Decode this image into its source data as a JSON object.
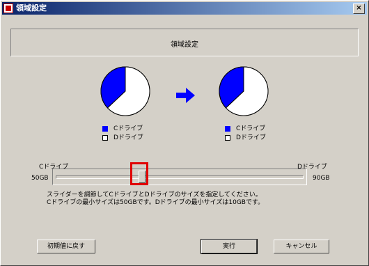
{
  "window": {
    "title": "領域設定",
    "close_glyph": "×"
  },
  "header": {
    "label": "領域設定"
  },
  "charts": {
    "type": "pie",
    "before": {
      "slices": [
        {
          "name": "Cドライブ",
          "fraction": 0.37,
          "color": "#0000ff"
        },
        {
          "name": "Dドライブ",
          "fraction": 0.63,
          "color": "#ffffff"
        }
      ]
    },
    "after": {
      "slices": [
        {
          "name": "Cドライブ",
          "fraction": 0.37,
          "color": "#0000ff"
        },
        {
          "name": "Dドライブ",
          "fraction": 0.63,
          "color": "#ffffff"
        }
      ]
    },
    "arrow_color": "#0000ff"
  },
  "legend_left": [
    {
      "label": "Cドライブ",
      "color": "#0000ff"
    },
    {
      "label": "Dドライブ",
      "color": "#ffffff"
    }
  ],
  "legend_right": [
    {
      "label": "Cドライブ",
      "color": "#0000ff"
    },
    {
      "label": "Dドライブ",
      "color": "#ffffff"
    }
  ],
  "slider": {
    "left_drive_label": "Cドライブ",
    "right_drive_label": "Dドライブ",
    "min_label": "50GB",
    "max_label": "90GB",
    "position_fraction": 0.35
  },
  "info": {
    "line1": "スライダーを調節してCドライブとDドライブのサイズを指定してください。",
    "line2": "Cドライブの最小サイズは50GBです。Dドライブの最小サイズは10GBです。"
  },
  "buttons": {
    "reset": "初期値に戻す",
    "execute": "実行",
    "cancel": "キャンセル"
  }
}
